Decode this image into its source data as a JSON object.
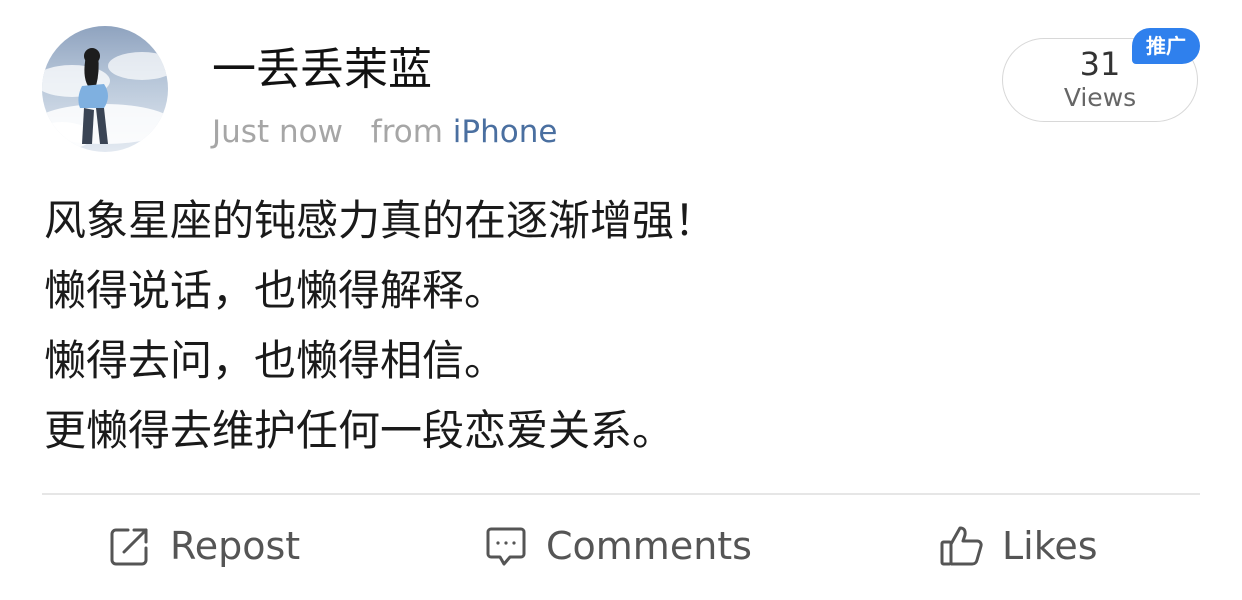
{
  "author": {
    "name": "一丢丢茉蓝",
    "time": "Just now",
    "from_label": "from",
    "source": "iPhone"
  },
  "views": {
    "count": "31",
    "label": "Views",
    "badge": "推广"
  },
  "post": {
    "lines": [
      "风象星座的钝感力真的在逐渐增强！",
      "懒得说话，也懒得解释。",
      "懒得去问，也懒得相信。",
      "更懒得去维护任何一段恋爱关系。"
    ]
  },
  "actions": {
    "repost": {
      "label": "Repost",
      "icon": "repost-icon"
    },
    "comments": {
      "label": "Comments",
      "icon": "comment-icon"
    },
    "likes": {
      "label": "Likes",
      "icon": "thumbs-up-icon"
    }
  },
  "colors": {
    "source_link": "#4a6fa0",
    "meta_text": "#a6a6a6",
    "badge_bg": "#2f80ed",
    "action_text": "#555555"
  }
}
